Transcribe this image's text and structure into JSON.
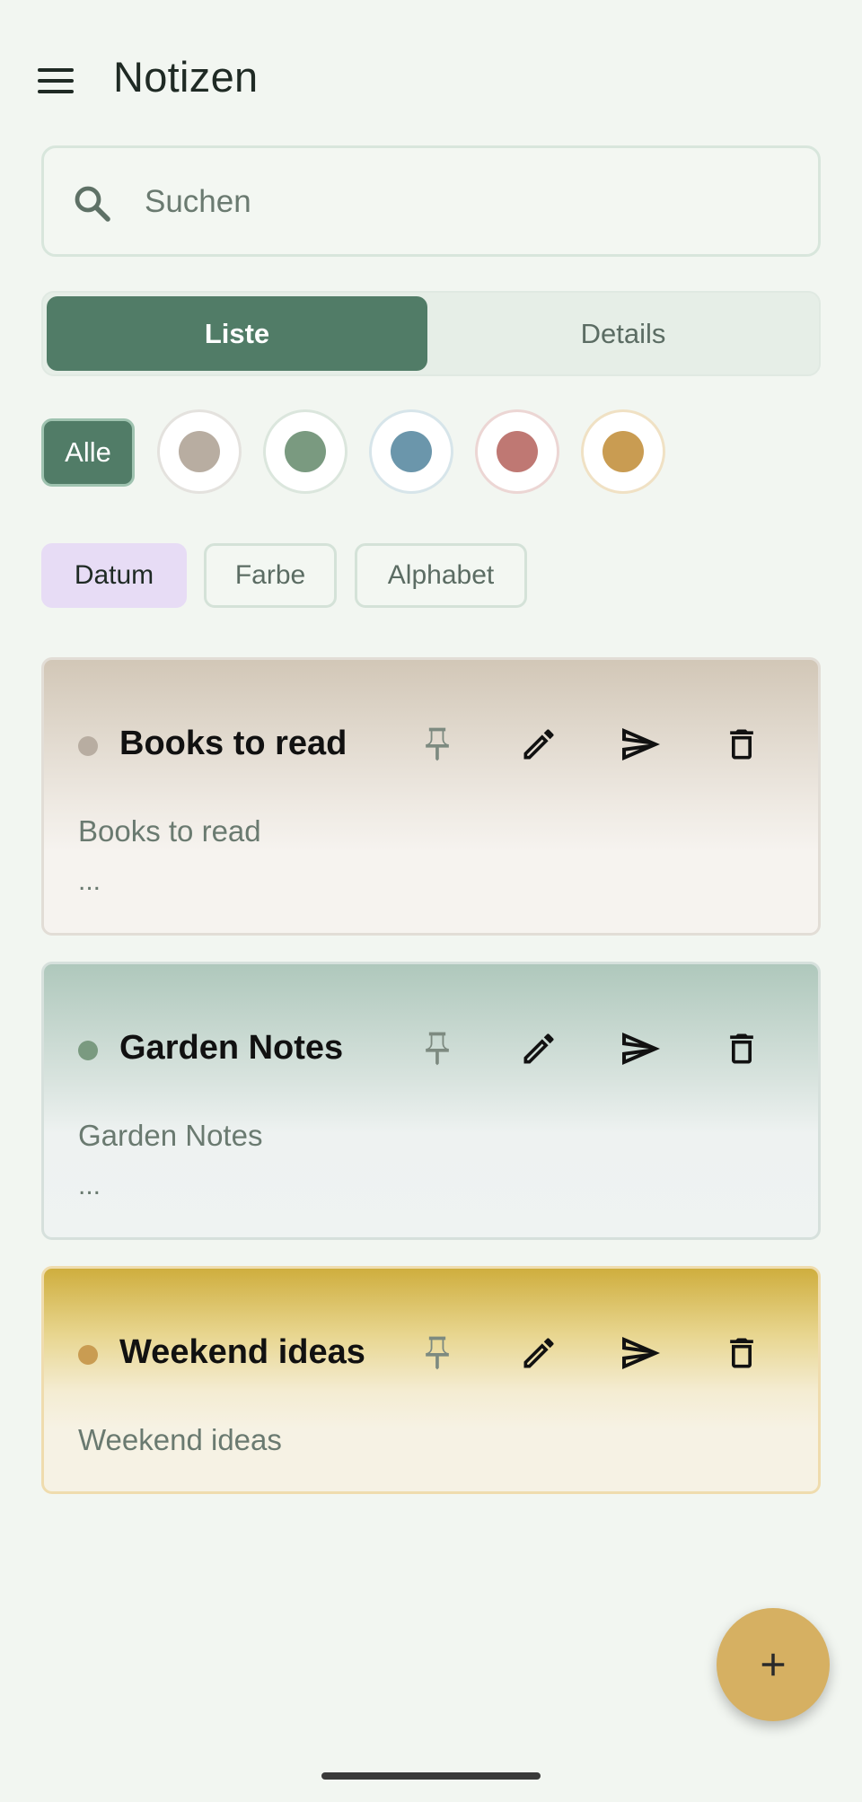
{
  "app": {
    "title": "Notizen"
  },
  "search": {
    "placeholder": "Suchen"
  },
  "view_toggle": {
    "list_label": "Liste",
    "details_label": "Details",
    "selected": "Liste"
  },
  "color_filter": {
    "all_label": "Alle",
    "colors": [
      "#b8ada1",
      "#7a9a80",
      "#6b96ab",
      "#bf7873",
      "#c99c52"
    ]
  },
  "sort": {
    "options": [
      "Datum",
      "Farbe",
      "Alphabet"
    ],
    "selected": "Datum"
  },
  "notes": [
    {
      "title": "Books to read",
      "preview": "Books to read",
      "more": "...",
      "color": "#b8ada1"
    },
    {
      "title": "Garden Notes",
      "preview": "Garden Notes",
      "more": "...",
      "color": "#7a9a80"
    },
    {
      "title": "Weekend ideas",
      "preview": "Weekend ideas",
      "more": "",
      "color": "#c99c52"
    }
  ],
  "icons": {
    "menu": "menu-icon",
    "search": "search-icon",
    "pin": "pin-icon",
    "edit": "pencil-icon",
    "send": "send-icon",
    "delete": "trash-icon",
    "add": "plus-icon"
  }
}
